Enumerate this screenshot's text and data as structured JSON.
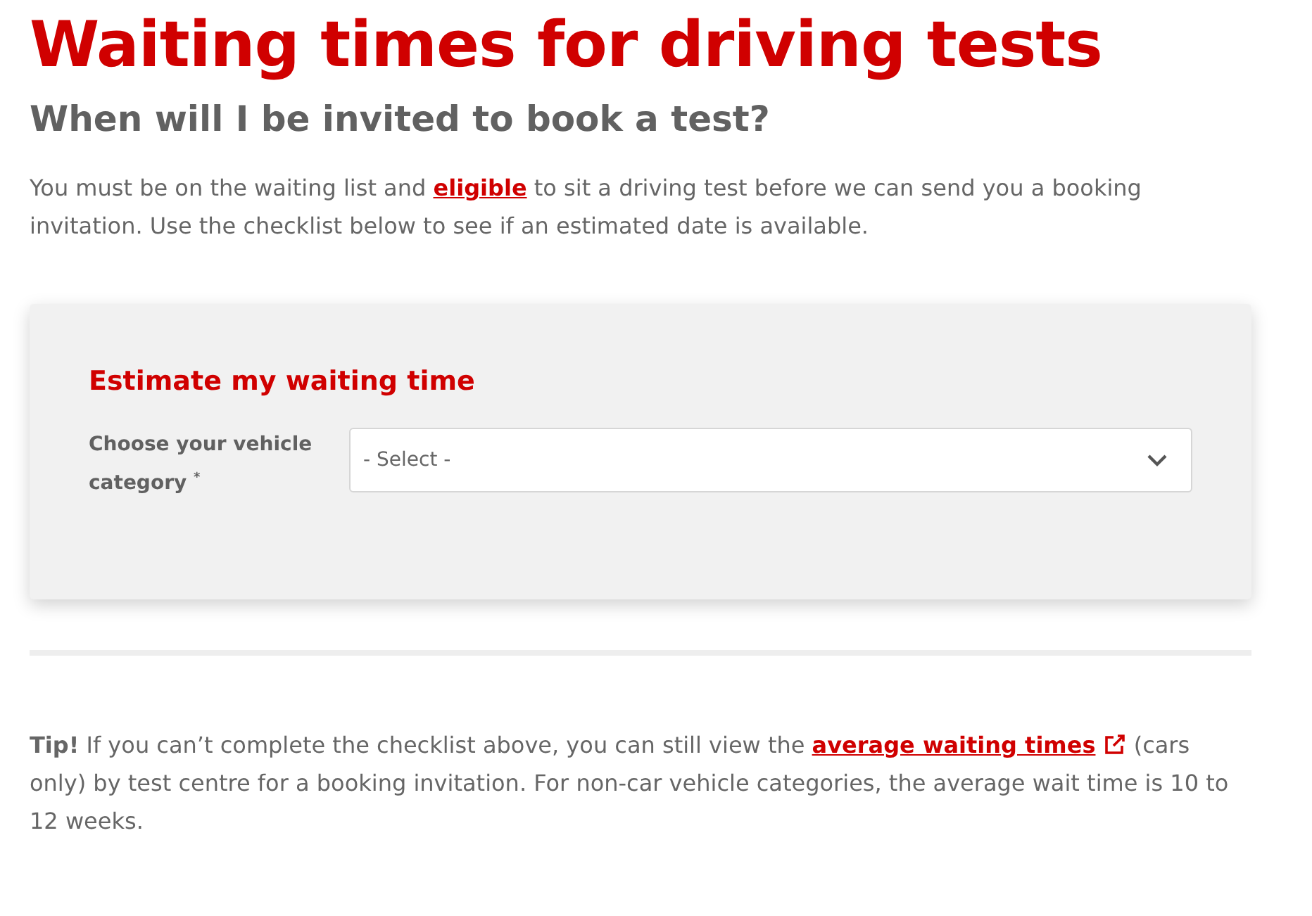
{
  "title": "Waiting times for driving tests",
  "subtitle": "When will I be invited to book a test?",
  "intro": {
    "before": "You must be on the waiting list and ",
    "link": "eligible",
    "after": " to sit a driving test before we can send you a booking invitation. Use the checklist below to see if an estimated date is available."
  },
  "estimator": {
    "title": "Estimate my waiting time",
    "field_label": "Choose your vehicle category",
    "required_mark": "*",
    "select_value": "- Select -"
  },
  "tip": {
    "before": "**Tip!** If you can’t complete the checklist above, you can still view the ",
    "link": "average waiting times",
    "after": " (cars only) by test centre for a booking invitation. For non-car vehicle categories, the average wait time is 10 to 12 weeks."
  }
}
